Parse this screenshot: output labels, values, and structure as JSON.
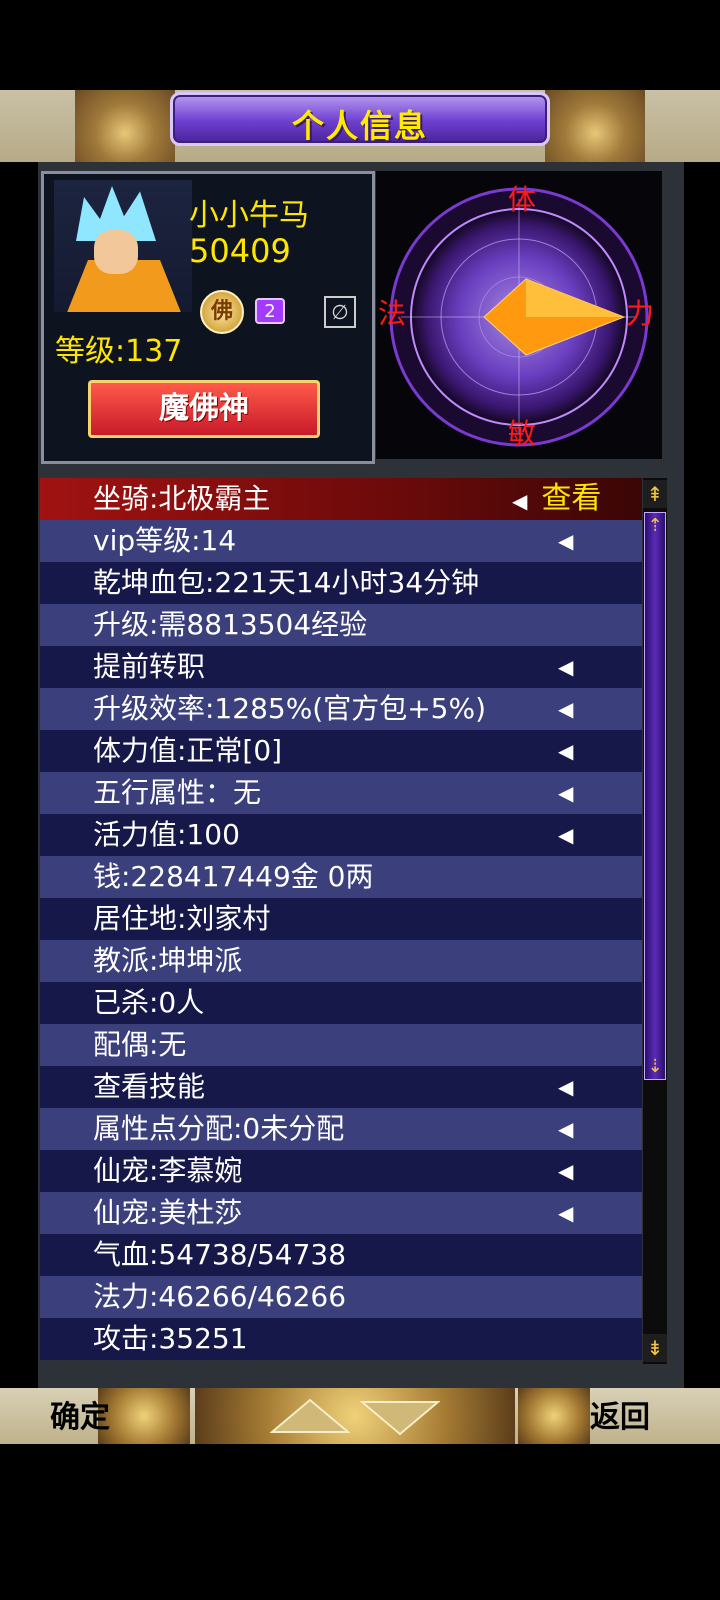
{
  "header": {
    "title": "个人信息"
  },
  "profile": {
    "name": "小小牛马",
    "id": "50409",
    "level": "等级:137",
    "badge_fo": "佛",
    "badge_number": "2",
    "empty_slot": "∅",
    "title": "魔佛神"
  },
  "compass": {
    "north": "体",
    "east": "力",
    "south": "敏",
    "west": "法"
  },
  "list": {
    "rows": [
      {
        "text": "坐骑:北极霸主",
        "action": "查看"
      },
      {
        "text": "vip等级:14"
      },
      {
        "text": "乾坤血包:221天14小时34分钟"
      },
      {
        "text": "升级:需8813504经验"
      },
      {
        "text": "提前转职"
      },
      {
        "text": "升级效率:1285%(官方包+5%)"
      },
      {
        "text": "体力值:正常[0]"
      },
      {
        "text": "五行属性：无"
      },
      {
        "text": "活力值:100"
      },
      {
        "text": "钱:228417449金 0两"
      },
      {
        "text": "居住地:刘家村"
      },
      {
        "text": "教派:坤坤派"
      },
      {
        "text": "已杀:0人"
      },
      {
        "text": "配偶:无"
      },
      {
        "text": "查看技能"
      },
      {
        "text": "属性点分配:0未分配"
      },
      {
        "text": "仙宠:李慕婉"
      },
      {
        "text": "仙宠:美杜莎"
      },
      {
        "text": "气血:54738/54738"
      },
      {
        "text": "法力:46266/46266"
      },
      {
        "text": "攻击:35251"
      }
    ]
  },
  "footer": {
    "ok": "确定",
    "back": "返回"
  }
}
